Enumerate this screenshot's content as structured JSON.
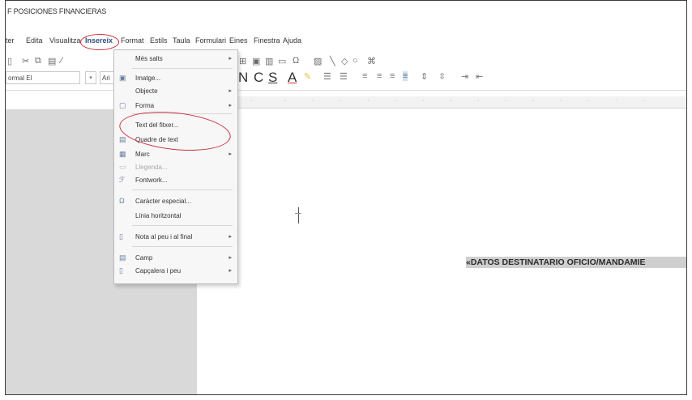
{
  "window": {
    "title": "F POSICIONES FINANCIERAS"
  },
  "menubar": {
    "items": [
      {
        "label": "ter"
      },
      {
        "label": "Edita"
      },
      {
        "label": "Visualitza"
      },
      {
        "label": "Insereix"
      },
      {
        "label": "Format"
      },
      {
        "label": "Estils"
      },
      {
        "label": "Taula"
      },
      {
        "label": "Formulari"
      },
      {
        "label": "Eines"
      },
      {
        "label": "Finestra"
      },
      {
        "label": "Ajuda"
      }
    ]
  },
  "toolbar": {
    "style_value": "ormal El",
    "font_value": "Ari",
    "format_letters": [
      "N",
      "C",
      "S",
      "A"
    ]
  },
  "insert_menu": {
    "items": [
      {
        "label": "Més salts",
        "icon": "",
        "submenu": true
      },
      {
        "label": "Imatge...",
        "icon": "image-icon",
        "submenu": false
      },
      {
        "label": "Objecte",
        "icon": "",
        "submenu": true
      },
      {
        "label": "Forma",
        "icon": "shape-icon",
        "submenu": true
      },
      {
        "label": "Text del fitxer...",
        "icon": "",
        "submenu": false
      },
      {
        "label": "Quadre de text",
        "icon": "textbox-icon",
        "submenu": false
      },
      {
        "label": "Marc",
        "icon": "frame-icon",
        "submenu": true
      },
      {
        "label": "Llegenda...",
        "icon": "caption-icon",
        "submenu": false,
        "disabled": true
      },
      {
        "label": "Fontwork...",
        "icon": "fontwork-icon",
        "submenu": false
      },
      {
        "label": "Caràcter especial...",
        "icon": "omega-icon",
        "submenu": false
      },
      {
        "label": "Línia horitzontal",
        "icon": "",
        "submenu": false
      },
      {
        "label": "Nota al peu i al final",
        "icon": "footnote-icon",
        "submenu": true
      },
      {
        "label": "Camp",
        "icon": "field-icon",
        "submenu": true
      },
      {
        "label": "Capçalera i peu",
        "icon": "header-icon",
        "submenu": true
      }
    ]
  },
  "document": {
    "field_text": "«DATOS DESTINATARIO OFICIO/MANDAMIE"
  },
  "colors": {
    "annotation": "#c9303d",
    "field_shading": "#cfcfcf",
    "sidebar_gray": "#d9d9d9"
  }
}
